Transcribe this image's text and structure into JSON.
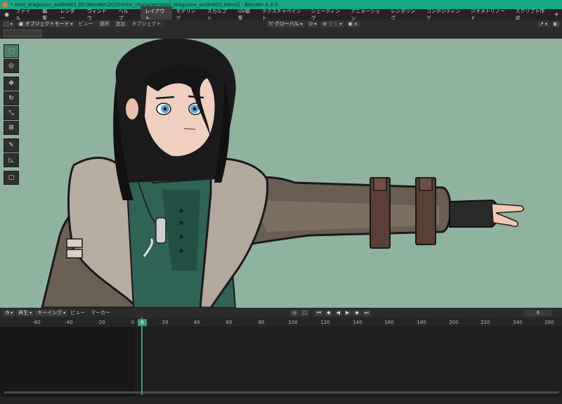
{
  "window": {
    "title": "* mini_dragunov_outline01 [D:\\blender\\2025\\mini_character\\mini_dragunov_outline01.blend] - Blender 4.3.0"
  },
  "menu": {
    "items": [
      "ファイル",
      "編集",
      "レンダー",
      "ウィンドウ",
      "ヘルプ"
    ]
  },
  "workspaces": [
    "レイアウト",
    "モデリング",
    "スカルプト",
    "UV編集",
    "テクスチャペイント",
    "シェーディング",
    "アニメーション",
    "レンダリング",
    "コンポジティング",
    "ジオメトリノード",
    "スクリプト作成"
  ],
  "header": {
    "mode": "オブジェクトモード",
    "view": "ビュー",
    "select": "選択",
    "add": "追加",
    "object": "オブジェクト",
    "transform": "グローバル"
  },
  "timeline": {
    "playback": "再生",
    "keying": "キーイング",
    "view": "ビュー",
    "marker": "マーカー",
    "current_frame": "6",
    "ticks": [
      "-60",
      "-40",
      "-20",
      "0",
      "20",
      "40",
      "60",
      "80",
      "100",
      "120",
      "140",
      "160",
      "180",
      "200",
      "220",
      "240",
      "260"
    ]
  },
  "colors": {
    "titlebar": "#17a789",
    "viewport_bg": "#8fb39f",
    "playhead": "#3d9b84"
  }
}
